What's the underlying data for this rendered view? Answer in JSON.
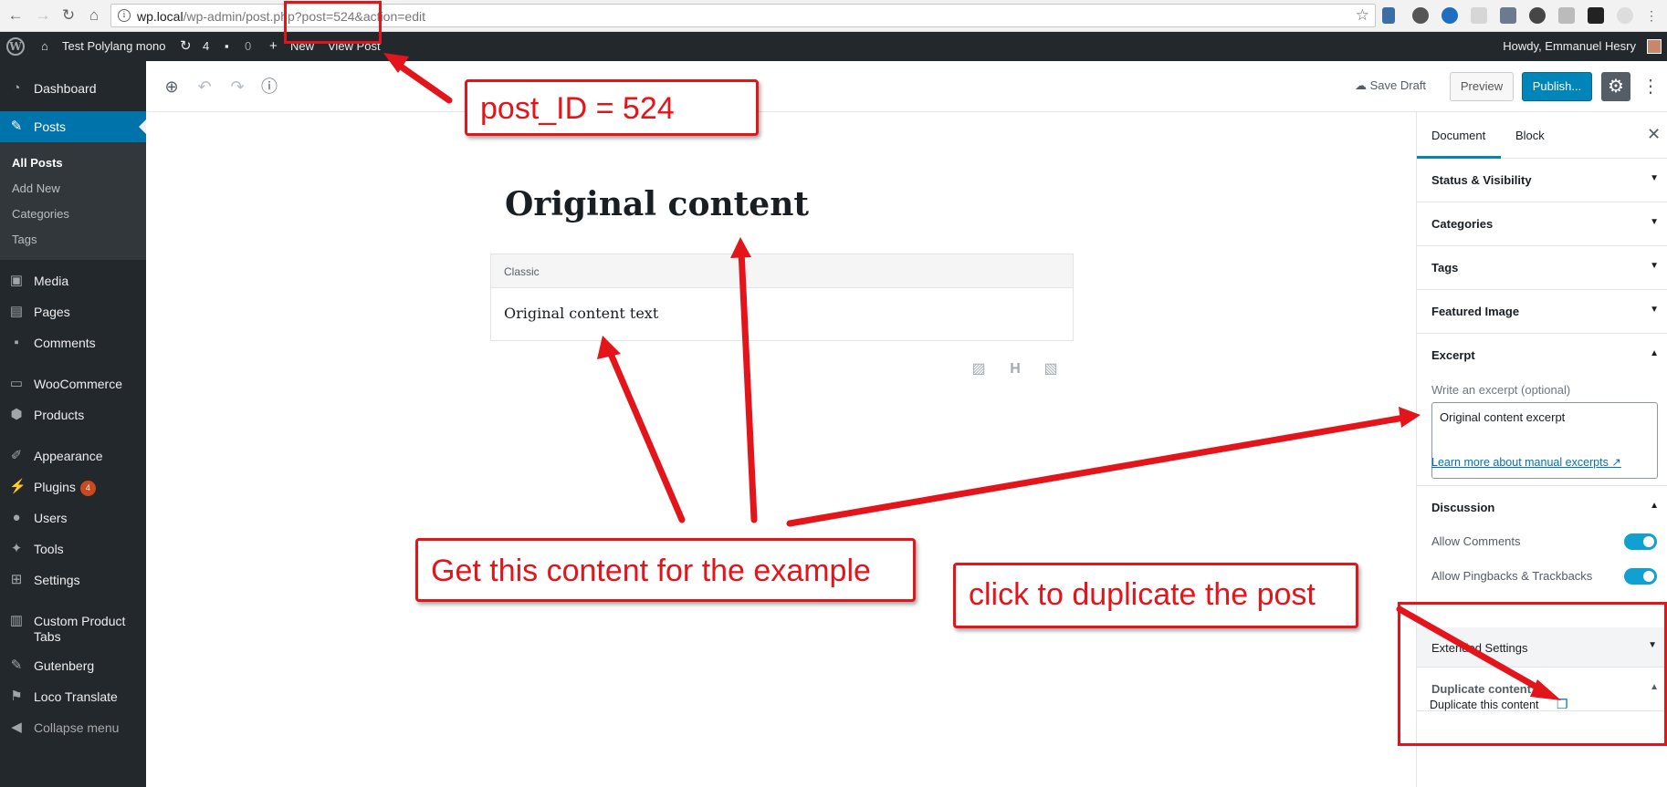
{
  "browser": {
    "url_host": "wp.local",
    "url_path": "/wp-admin/post.php?post=524&action=edit"
  },
  "adminbar": {
    "site_name": "Test Polylang mono",
    "updates_count": "4",
    "comments_count": "0",
    "new_label": "New",
    "view_post_label": "View Post",
    "howdy": "Howdy, Emmanuel Hesry"
  },
  "menu": {
    "dashboard": "Dashboard",
    "posts": "Posts",
    "posts_sub": [
      "All Posts",
      "Add New",
      "Categories",
      "Tags"
    ],
    "media": "Media",
    "pages": "Pages",
    "comments": "Comments",
    "woocommerce": "WooCommerce",
    "products": "Products",
    "appearance": "Appearance",
    "plugins": "Plugins",
    "plugins_badge": "4",
    "users": "Users",
    "tools": "Tools",
    "settings": "Settings",
    "custom_product_tabs_1": "Custom Product",
    "custom_product_tabs_2": "Tabs",
    "gutenberg": "Gutenberg",
    "loco_translate": "Loco Translate",
    "collapse": "Collapse menu"
  },
  "editor_header": {
    "save_draft": "Save Draft",
    "preview": "Preview",
    "publish": "Publish..."
  },
  "post": {
    "title": "Original content",
    "block_label": "Classic",
    "block_text": "Original content text"
  },
  "sidebar": {
    "tab_document": "Document",
    "tab_block": "Block",
    "panels": [
      "Status & Visibility",
      "Categories",
      "Tags",
      "Featured Image"
    ],
    "excerpt_title": "Excerpt",
    "excerpt_label": "Write an excerpt (optional)",
    "excerpt_value": "Original content excerpt",
    "excerpt_link": "Learn more about manual excerpts",
    "discussion_title": "Discussion",
    "allow_comments": "Allow Comments",
    "allow_pingbacks": "Allow Pingbacks & Trackbacks",
    "extended_settings": "Extended Settings",
    "duplicate_content_title": "Duplicate content",
    "duplicate_this": "Duplicate this content"
  },
  "annotations": {
    "post_id": "post_ID = 524",
    "get_content": "Get this content for the example",
    "click_duplicate": "click to duplicate the post"
  },
  "colors": {
    "accent": "#0085ba",
    "admin_dark": "#23282d",
    "annotation_red": "#e4141b"
  }
}
